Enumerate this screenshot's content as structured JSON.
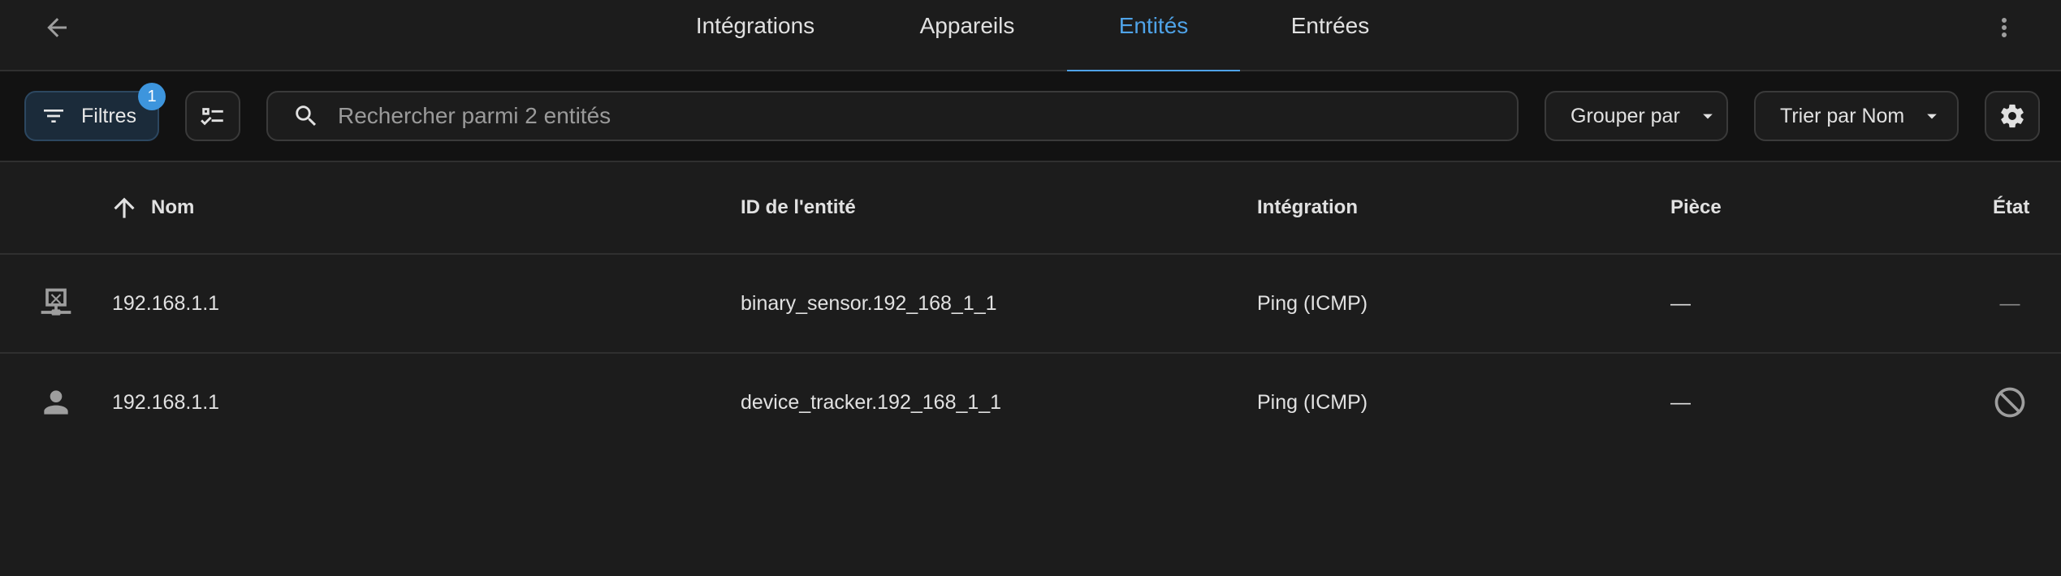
{
  "header": {
    "tabs": [
      {
        "label": "Intégrations",
        "active": false
      },
      {
        "label": "Appareils",
        "active": false
      },
      {
        "label": "Entités",
        "active": true
      },
      {
        "label": "Entrées",
        "active": false
      }
    ],
    "back_icon": "arrow-left-icon",
    "overflow_icon": "dots-vertical-icon"
  },
  "toolbar": {
    "filters_label": "Filtres",
    "filters_badge": "1",
    "search_placeholder": "Rechercher parmi 2 entités",
    "group_label": "Grouper par",
    "sort_label": "Trier par Nom"
  },
  "table": {
    "columns": {
      "name": "Nom",
      "entity_id": "ID de l'entité",
      "integration": "Intégration",
      "area": "Pièce",
      "status": "État"
    },
    "rows": [
      {
        "icon": "lan-disconnect-icon",
        "name": "192.168.1.1",
        "entity_id": "binary_sensor.192_168_1_1",
        "integration": "Ping (ICMP)",
        "area": "—",
        "status": "—"
      },
      {
        "icon": "account-icon",
        "name": "192.168.1.1",
        "entity_id": "device_tracker.192_168_1_1",
        "integration": "Ping (ICMP)",
        "area": "—",
        "status_icon": "cancel-icon"
      }
    ]
  },
  "colors": {
    "accent": "#4fa3e8",
    "background": "#1c1c1c",
    "toolbar_background": "#121212"
  }
}
